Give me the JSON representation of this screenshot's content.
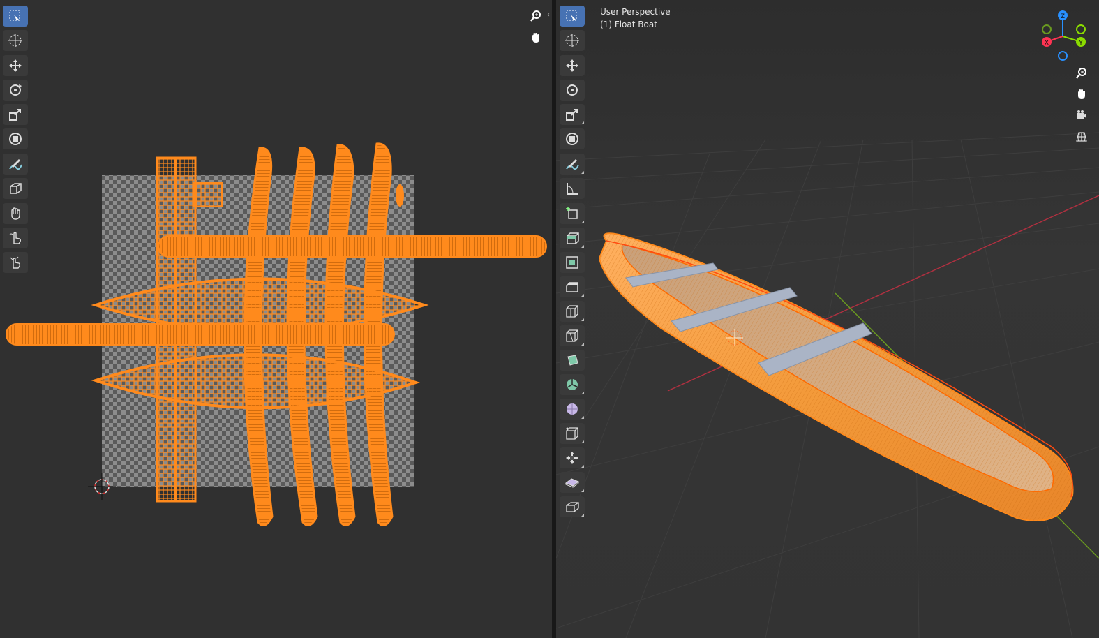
{
  "uv_editor": {
    "tools": [
      {
        "icon": "select-box-icon",
        "active": true
      },
      {
        "icon": "cursor-icon"
      },
      {
        "icon": "move-icon",
        "gap": true
      },
      {
        "icon": "rotate-icon"
      },
      {
        "icon": "scale-icon"
      },
      {
        "icon": "transform-icon"
      },
      {
        "icon": "annotate-icon",
        "gap": true
      },
      {
        "icon": "box-icon"
      },
      {
        "icon": "grab-icon",
        "gap": true
      },
      {
        "icon": "relax-icon"
      },
      {
        "icon": "pinch-icon"
      }
    ],
    "nav": [
      {
        "icon": "zoom-icon"
      },
      {
        "icon": "hand-pan-icon"
      }
    ]
  },
  "viewport_3d": {
    "header": {
      "view_name": "User Perspective",
      "object_name": "(1) Float Boat"
    },
    "gizmo_axes": [
      "Z",
      "Y",
      "X"
    ],
    "nav": [
      {
        "icon": "zoom-icon"
      },
      {
        "icon": "hand-pan-icon"
      },
      {
        "icon": "camera-icon"
      },
      {
        "icon": "grid-icon"
      }
    ]
  },
  "colors": {
    "selection_orange": "#ff8a1c",
    "active_tool_blue": "#4772b3",
    "axis_x": "#ff3352",
    "axis_y": "#8bdc00",
    "axis_z": "#2890ff"
  }
}
